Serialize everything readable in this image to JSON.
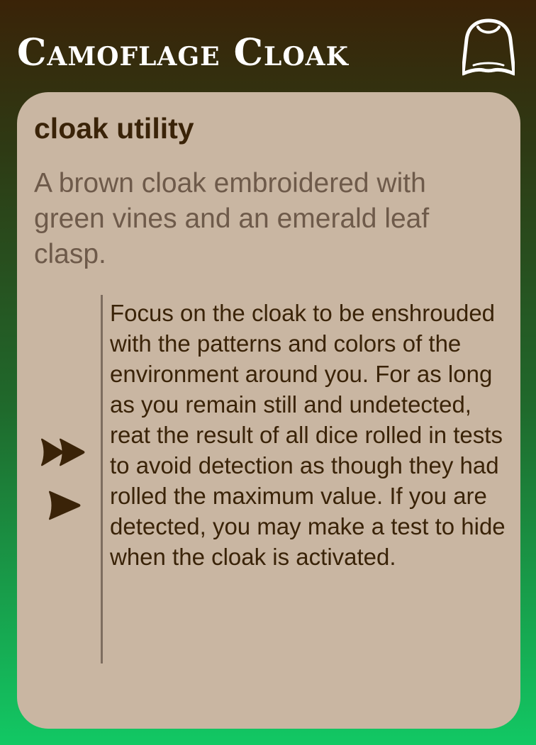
{
  "card": {
    "title": "Camoflage Cloak",
    "icon": "cloak-icon",
    "type_line": "cloak utility",
    "flavor": "A brown cloak embroidered with green vines and an emerald leaf clasp.",
    "ability": {
      "cost_icons": [
        "double-arrow-icon",
        "single-arrow-icon"
      ],
      "text": "Focus on the cloak to be enshrouded with the patterns and colors of the environment around you. For as long as you remain still and undetected, reat the result of all dice rolled in tests to avoid detection as though they had rolled the maximum value. If you are detected, you may make a test to hide when the cloak is activated."
    }
  },
  "colors": {
    "gradient_top": "#3a2308",
    "gradient_bottom": "#12c864",
    "panel": "#c9b6a2",
    "dark_text": "#3a2308",
    "flavor_text": "#6e5a4a",
    "title_text": "#ffffff"
  }
}
